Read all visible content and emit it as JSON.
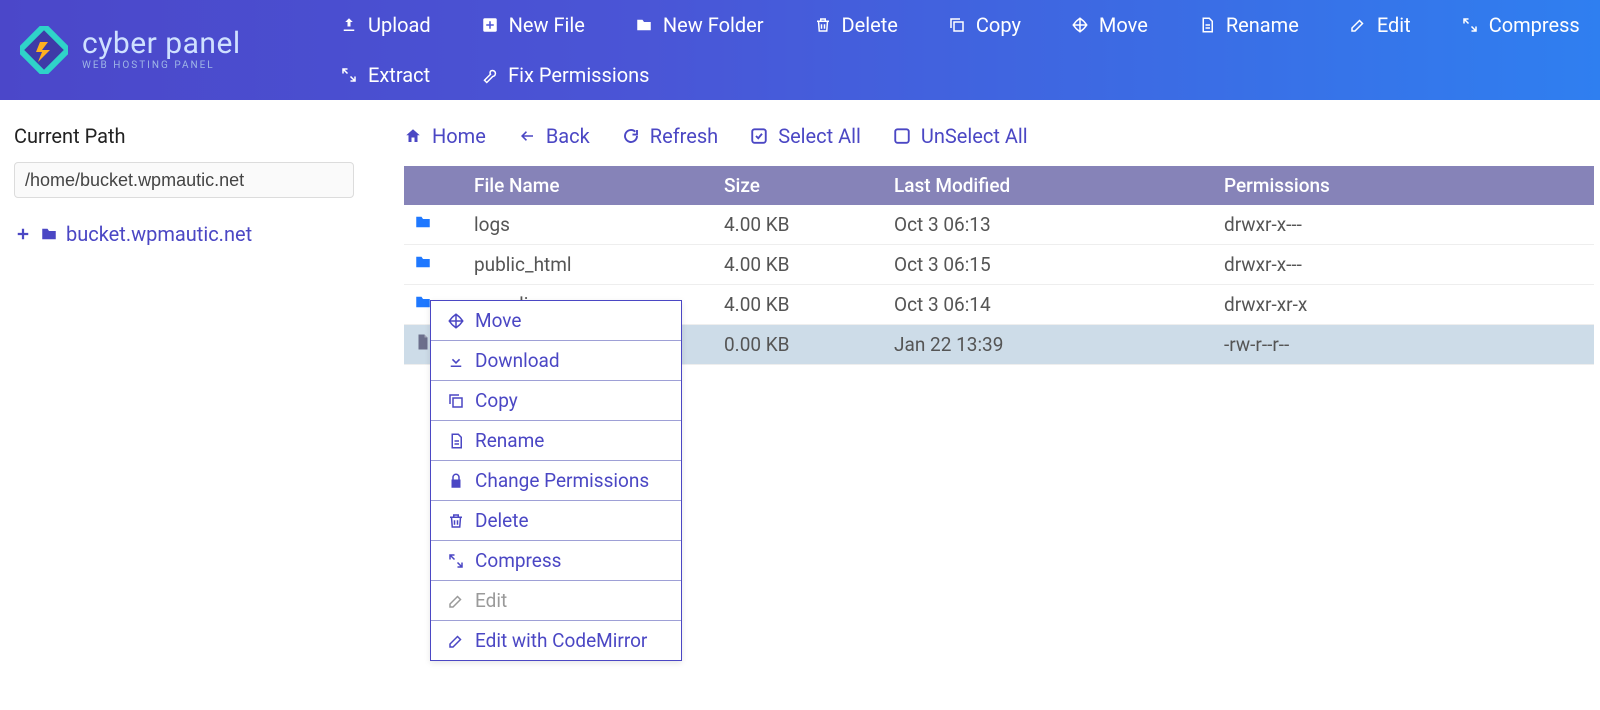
{
  "brand": {
    "name": "cyber panel",
    "tagline": "WEB HOSTING PANEL"
  },
  "toolbar": {
    "upload": "Upload",
    "new_file": "New File",
    "new_folder": "New Folder",
    "delete": "Delete",
    "copy": "Copy",
    "move": "Move",
    "rename": "Rename",
    "edit": "Edit",
    "compress": "Compress",
    "extract": "Extract",
    "fix_permissions": "Fix Permissions"
  },
  "sidebar": {
    "heading": "Current Path",
    "path_value": "/home/bucket.wpmautic.net",
    "tree_root": "bucket.wpmautic.net"
  },
  "actions": {
    "home": "Home",
    "back": "Back",
    "refresh": "Refresh",
    "select_all": "Select All",
    "unselect_all": "UnSelect All"
  },
  "table": {
    "headers": {
      "name": "File Name",
      "size": "Size",
      "modified": "Last Modified",
      "permissions": "Permissions"
    },
    "rows": [
      {
        "type": "folder",
        "name": "logs",
        "size": "4.00 KB",
        "modified": "Oct 3 06:13",
        "permissions": "drwxr-x---",
        "selected": false
      },
      {
        "type": "folder",
        "name": "public_html",
        "size": "4.00 KB",
        "modified": "Oct 3 06:15",
        "permissions": "drwxr-x---",
        "selected": false
      },
      {
        "type": "folder",
        "name": ".wp-cli",
        "size": "4.00 KB",
        "modified": "Oct 3 06:14",
        "permissions": "drwxr-xr-x",
        "selected": false
      },
      {
        "type": "file",
        "name": "",
        "size": "0.00 KB",
        "modified": "Jan 22 13:39",
        "permissions": "-rw-r--r--",
        "selected": true
      }
    ]
  },
  "context_menu": {
    "items": [
      {
        "key": "move",
        "label": "Move",
        "icon": "move-icon",
        "muted": false
      },
      {
        "key": "download",
        "label": "Download",
        "icon": "download-icon",
        "muted": false
      },
      {
        "key": "copy",
        "label": "Copy",
        "icon": "copy-icon",
        "muted": false
      },
      {
        "key": "rename",
        "label": "Rename",
        "icon": "file-text-icon",
        "muted": false
      },
      {
        "key": "chperm",
        "label": "Change Permissions",
        "icon": "lock-icon",
        "muted": false
      },
      {
        "key": "delete",
        "label": "Delete",
        "icon": "trash-icon",
        "muted": false
      },
      {
        "key": "compress",
        "label": "Compress",
        "icon": "compress-icon",
        "muted": false
      },
      {
        "key": "edit",
        "label": "Edit",
        "icon": "edit-icon",
        "muted": true
      },
      {
        "key": "edit_cm",
        "label": "Edit with CodeMirror",
        "icon": "edit-icon",
        "muted": false
      }
    ]
  }
}
